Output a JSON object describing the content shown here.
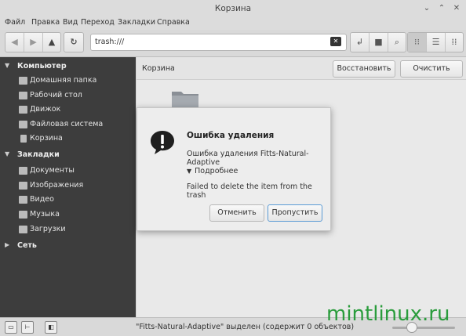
{
  "window": {
    "title": "Корзина"
  },
  "menu": [
    "Файл",
    "Правка",
    "Вид",
    "Переход",
    "Закладки",
    "Справка"
  ],
  "toolbar": {
    "path": "trash:///"
  },
  "sidebar": {
    "computer_label": "Компьютер",
    "computer_items": [
      "Домашняя папка",
      "Рабочий стол",
      "Движок",
      "Файловая система",
      "Корзина"
    ],
    "bookmarks_label": "Закладки",
    "bookmark_items": [
      "Документы",
      "Изображения",
      "Видео",
      "Музыка",
      "Загрузки"
    ],
    "network_label": "Сеть"
  },
  "main": {
    "location": "Корзина",
    "restore_label": "Восстановить",
    "empty_label": "Очистить"
  },
  "dialog": {
    "title": "Ошибка удаления",
    "message": "Ошибка удаления Fitts-Natural-Adaptive",
    "details_label": "Подробнее",
    "error_text": "Failed to delete the item from the trash",
    "cancel_label": "Отменить",
    "skip_label": "Пропустить"
  },
  "status": {
    "text": "\"Fitts-Natural-Adaptive\" выделен (содержит 0 объектов)"
  },
  "watermark": "mintlinux.ru",
  "colors": {
    "sidebar_bg": "#3d3d3d",
    "watermark": "#2a9c3c",
    "primary_border": "#5b9bd5"
  }
}
